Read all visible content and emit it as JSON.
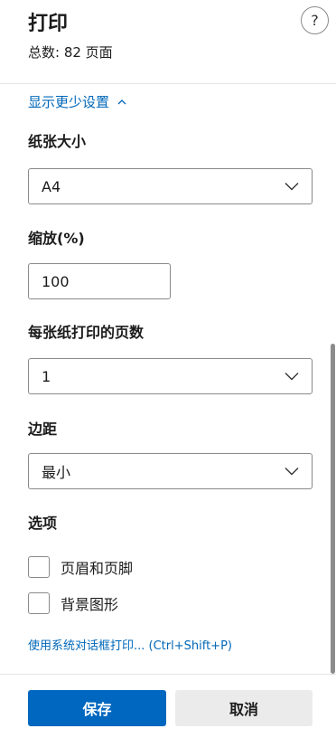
{
  "header": {
    "title": "打印",
    "total_pages": "总数: 82 页面",
    "help_label": "?"
  },
  "settings_toggle": "显示更少设置",
  "paper_size": {
    "label": "纸张大小",
    "value": "A4"
  },
  "scale": {
    "label": "缩放(%)",
    "value": "100"
  },
  "pages_per_sheet": {
    "label": "每张纸打印的页数",
    "value": "1"
  },
  "margins": {
    "label": "边距",
    "value": "最小"
  },
  "options": {
    "label": "选项",
    "items": [
      {
        "label": "页眉和页脚",
        "checked": false
      },
      {
        "label": "背景图形",
        "checked": false
      }
    ]
  },
  "system_dialog_link": "使用系统对话框打印... (Ctrl+Shift+P)",
  "footer": {
    "save_label": "保存",
    "cancel_label": "取消"
  },
  "colors": {
    "accent": "#0067c0",
    "link": "#0067b8"
  }
}
